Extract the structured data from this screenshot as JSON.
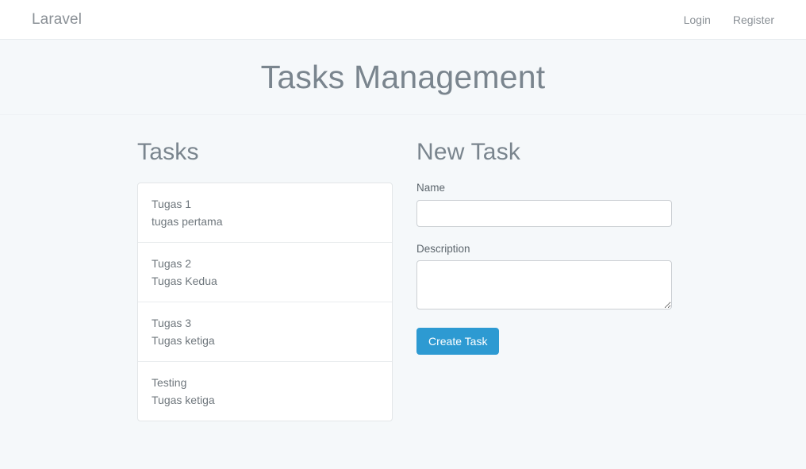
{
  "navbar": {
    "brand": "Laravel",
    "links": [
      {
        "label": "Login",
        "name": "nav-link-login"
      },
      {
        "label": "Register",
        "name": "nav-link-register"
      }
    ]
  },
  "header": {
    "title": "Tasks Management"
  },
  "tasks_panel": {
    "title": "Tasks",
    "items": [
      {
        "name": "Tugas 1",
        "description": "tugas pertama"
      },
      {
        "name": "Tugas 2",
        "description": "Tugas Kedua"
      },
      {
        "name": "Tugas 3",
        "description": "Tugas ketiga"
      },
      {
        "name": "Testing",
        "description": "Tugas ketiga"
      }
    ]
  },
  "new_task_form": {
    "title": "New Task",
    "name_label": "Name",
    "name_value": "",
    "name_placeholder": "",
    "description_label": "Description",
    "description_value": "",
    "description_placeholder": "",
    "submit_label": "Create Task"
  },
  "colors": {
    "page_background": "#f5f8fa",
    "navbar_background": "#ffffff",
    "heading_text": "#7a858e",
    "body_text": "#636b6f",
    "muted_link": "#8a9096",
    "primary_button": "#2d9ad2",
    "card_border": "#e3e6e8",
    "input_border": "#ccd0d4"
  }
}
